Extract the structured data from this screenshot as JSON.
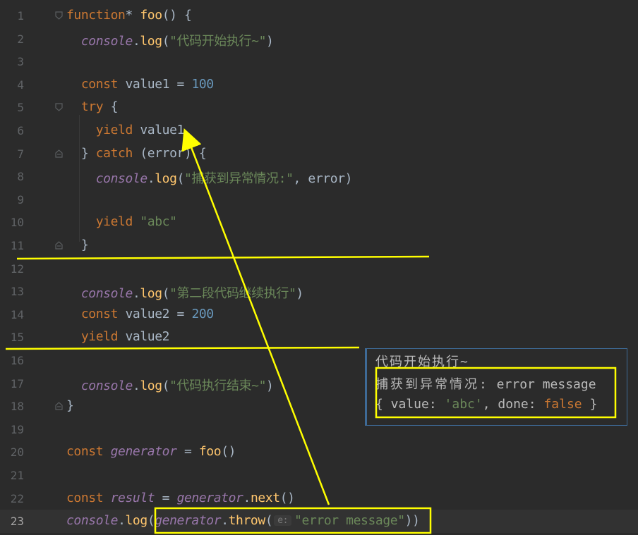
{
  "editor": {
    "lines": [
      {
        "num": "1",
        "tokens": [
          [
            "kw",
            "function"
          ],
          [
            "var",
            "* "
          ],
          [
            "fn",
            "foo"
          ],
          [
            "var",
            "() {"
          ]
        ]
      },
      {
        "num": "2",
        "tokens": [
          [
            "var",
            "  "
          ],
          [
            "obj",
            "console"
          ],
          [
            "var",
            "."
          ],
          [
            "mth",
            "log"
          ],
          [
            "var",
            "("
          ],
          [
            "str",
            "\"代码开始执行~\""
          ],
          [
            "var",
            ")"
          ]
        ]
      },
      {
        "num": "3",
        "tokens": []
      },
      {
        "num": "4",
        "tokens": [
          [
            "var",
            "  "
          ],
          [
            "kw",
            "const "
          ],
          [
            "var",
            "value1 = "
          ],
          [
            "num",
            "100"
          ]
        ]
      },
      {
        "num": "5",
        "tokens": [
          [
            "var",
            "  "
          ],
          [
            "kw",
            "try"
          ],
          [
            "var",
            " {"
          ]
        ]
      },
      {
        "num": "6",
        "tokens": [
          [
            "var",
            "    "
          ],
          [
            "kw",
            "yield "
          ],
          [
            "var",
            "value1"
          ]
        ]
      },
      {
        "num": "7",
        "tokens": [
          [
            "var",
            "  } "
          ],
          [
            "kw",
            "catch"
          ],
          [
            "var",
            " (error) {"
          ]
        ]
      },
      {
        "num": "8",
        "tokens": [
          [
            "var",
            "    "
          ],
          [
            "obj",
            "console"
          ],
          [
            "var",
            "."
          ],
          [
            "mth",
            "log"
          ],
          [
            "var",
            "("
          ],
          [
            "str",
            "\"捕获到异常情况:\""
          ],
          [
            "var",
            ", error)"
          ]
        ]
      },
      {
        "num": "9",
        "tokens": []
      },
      {
        "num": "10",
        "tokens": [
          [
            "var",
            "    "
          ],
          [
            "kw",
            "yield "
          ],
          [
            "str",
            "\"abc\""
          ]
        ]
      },
      {
        "num": "11",
        "tokens": [
          [
            "var",
            "  }"
          ]
        ]
      },
      {
        "num": "12",
        "tokens": []
      },
      {
        "num": "13",
        "tokens": [
          [
            "var",
            "  "
          ],
          [
            "obj",
            "console"
          ],
          [
            "var",
            "."
          ],
          [
            "mth",
            "log"
          ],
          [
            "var",
            "("
          ],
          [
            "str",
            "\"第二段代码继续执行\""
          ],
          [
            "var",
            ")"
          ]
        ]
      },
      {
        "num": "14",
        "tokens": [
          [
            "var",
            "  "
          ],
          [
            "kw",
            "const "
          ],
          [
            "var",
            "value2 = "
          ],
          [
            "num",
            "200"
          ]
        ]
      },
      {
        "num": "15",
        "tokens": [
          [
            "var",
            "  "
          ],
          [
            "kw",
            "yield "
          ],
          [
            "var",
            "value2"
          ]
        ]
      },
      {
        "num": "16",
        "tokens": []
      },
      {
        "num": "17",
        "tokens": [
          [
            "var",
            "  "
          ],
          [
            "obj",
            "console"
          ],
          [
            "var",
            "."
          ],
          [
            "mth",
            "log"
          ],
          [
            "var",
            "("
          ],
          [
            "str",
            "\"代码执行结束~\""
          ],
          [
            "var",
            ")"
          ]
        ]
      },
      {
        "num": "18",
        "tokens": [
          [
            "var",
            "}"
          ]
        ]
      },
      {
        "num": "19",
        "tokens": []
      },
      {
        "num": "20",
        "tokens": [
          [
            "kw",
            "const "
          ],
          [
            "ivar",
            "generator"
          ],
          [
            "var",
            " = "
          ],
          [
            "fn",
            "foo"
          ],
          [
            "var",
            "()"
          ]
        ]
      },
      {
        "num": "21",
        "tokens": []
      },
      {
        "num": "22",
        "tokens": [
          [
            "kw",
            "const "
          ],
          [
            "ivar",
            "result"
          ],
          [
            "var",
            " = "
          ],
          [
            "ivar",
            "generator"
          ],
          [
            "var",
            "."
          ],
          [
            "mth",
            "next"
          ],
          [
            "var",
            "()"
          ]
        ]
      },
      {
        "num": "23",
        "tokens": [
          [
            "obj",
            "console"
          ],
          [
            "var",
            "."
          ],
          [
            "mth",
            "log"
          ],
          [
            "var",
            "("
          ],
          [
            "ivar",
            "generator"
          ],
          [
            "var",
            "."
          ],
          [
            "mth",
            "throw"
          ],
          [
            "var",
            "("
          ],
          [
            "hint",
            "e:"
          ],
          [
            "str",
            "\"error message\""
          ],
          [
            "var",
            "))"
          ]
        ]
      }
    ],
    "current_line": "23"
  },
  "console_output": {
    "line1": "代码开始执行~",
    "line2_cjk": "捕获到异常情况:",
    "line2_rest": " error message",
    "line3_a": "{ value: ",
    "line3_str": "'abc'",
    "line3_b": ", done: ",
    "line3_bool": "false",
    "line3_c": " }"
  },
  "colors": {
    "annotation": "#ffff00",
    "background": "#2b2b2b",
    "keyword": "#cc7832",
    "string": "#6a8759",
    "number": "#6897bb",
    "object": "#9876aa",
    "method": "#ffc66d"
  }
}
